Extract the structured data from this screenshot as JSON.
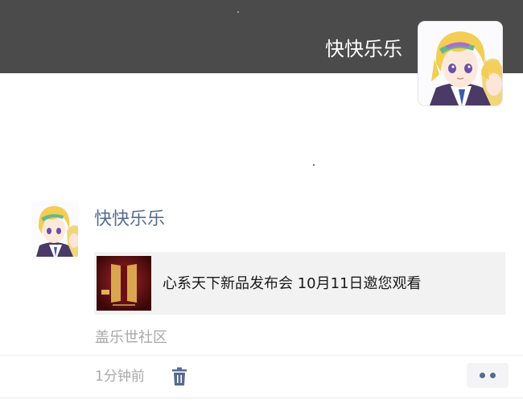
{
  "header": {
    "user_name": "快快乐乐",
    "avatar_icon": "anime-avatar"
  },
  "post": {
    "author_name": "快快乐乐",
    "avatar_icon": "anime-avatar",
    "link_card": {
      "thumbnail_icon": "product-launch-thumbnail",
      "title": "心系天下新品发布会 10月11日邀您观看"
    },
    "source": "盖乐世社区",
    "time": "1分钟前",
    "delete_icon": "trash-icon",
    "more_icon": "more-dots-icon"
  },
  "colors": {
    "header_bg": "#4b4b4b",
    "author_name": "#576b95",
    "link_card_bg": "#f2f2f2",
    "muted_text": "#a9a9a9",
    "action_dots": "#566a93"
  }
}
